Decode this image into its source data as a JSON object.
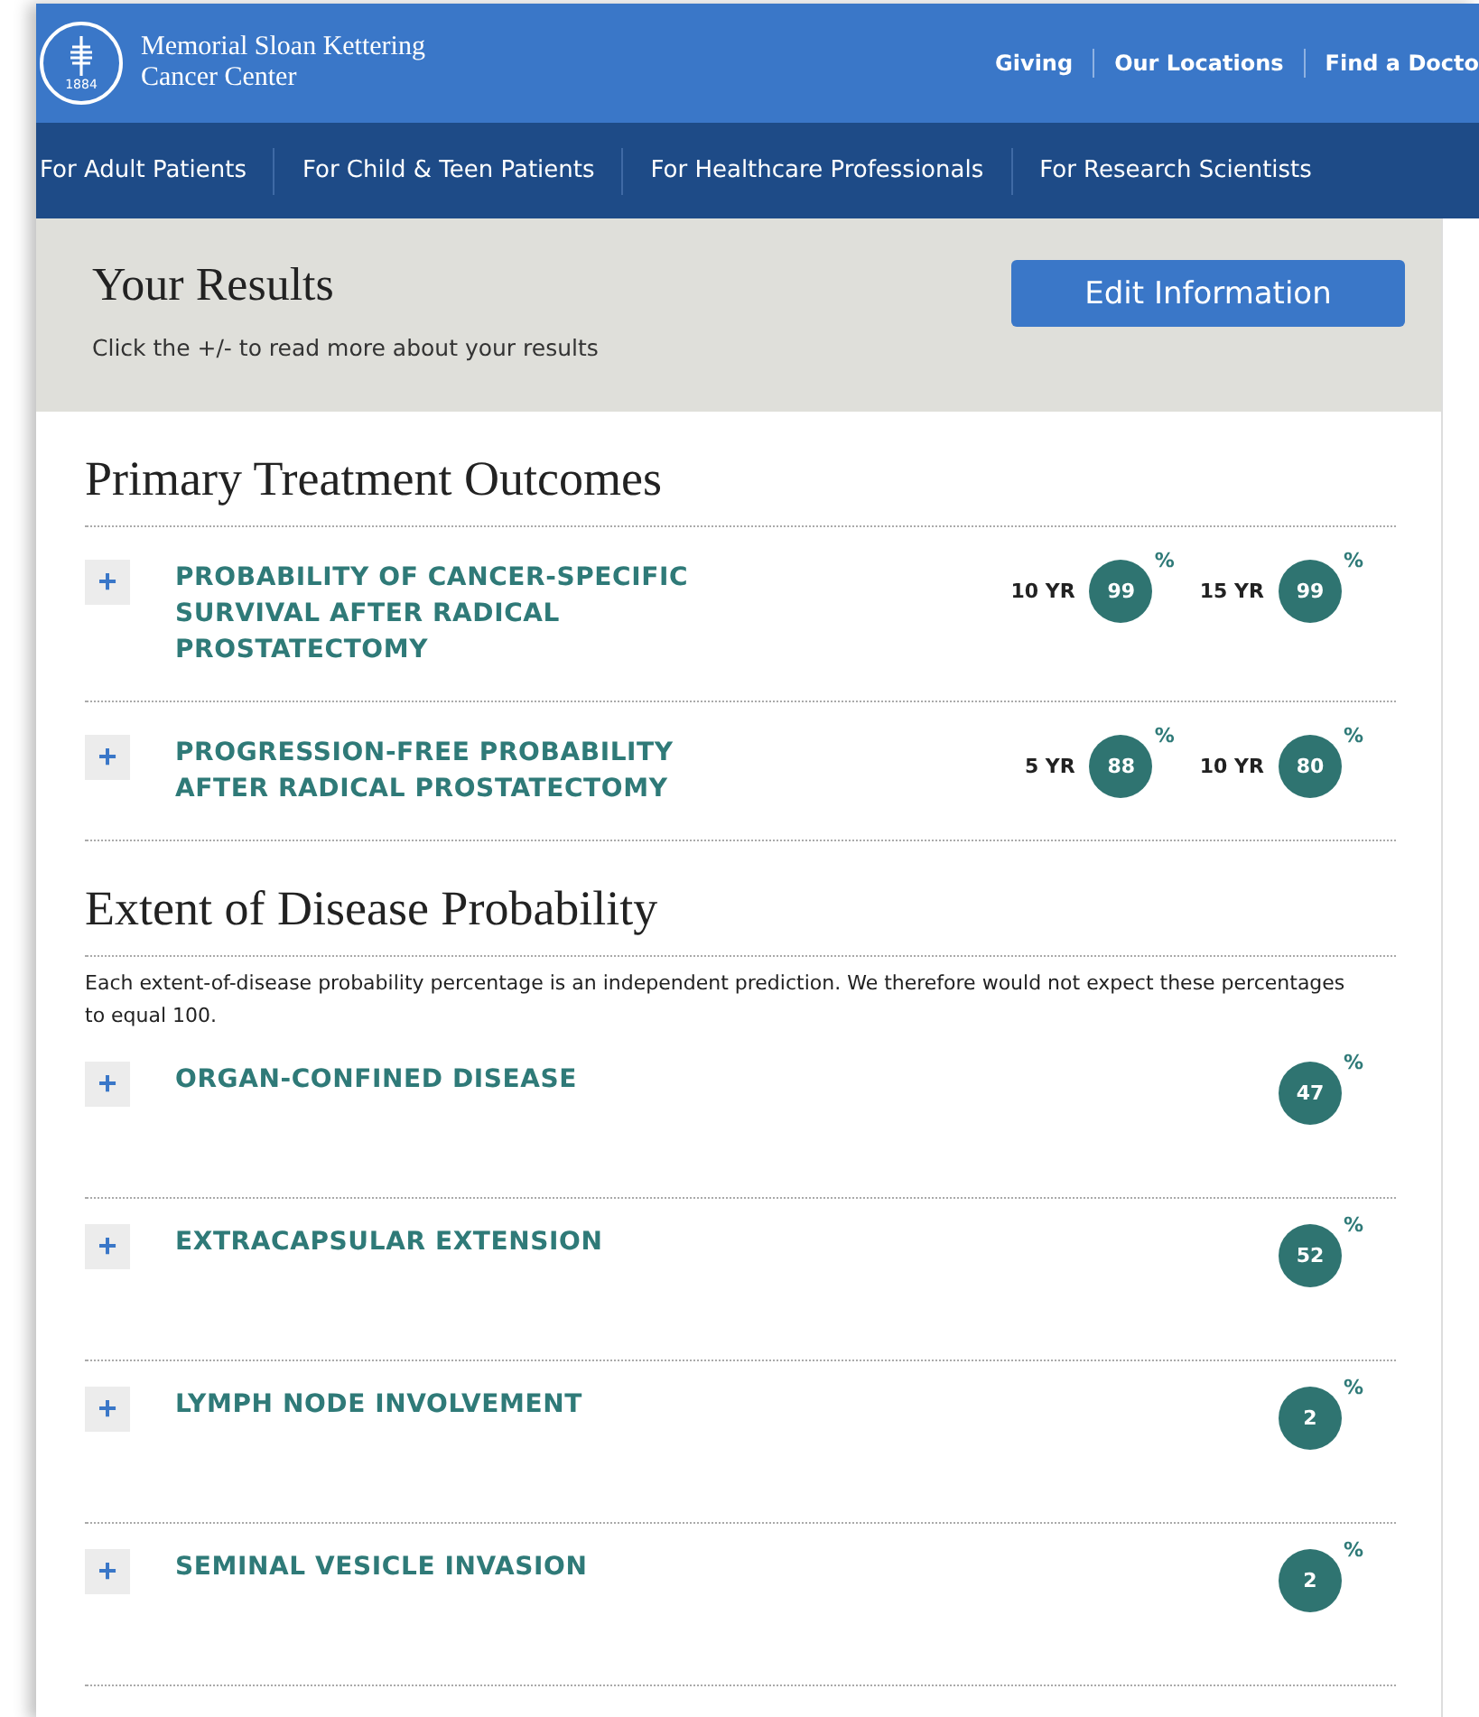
{
  "header": {
    "logo_year": "1884",
    "brand_line_1": "Memorial Sloan Kettering",
    "brand_line_2": "Cancer Center",
    "utility_links": [
      "Giving",
      "Our Locations",
      "Find a Docto"
    ]
  },
  "nav": {
    "items": [
      "For Adult Patients",
      "For Child & Teen Patients",
      "For Healthcare Professionals",
      "For Research Scientists"
    ]
  },
  "results_header": {
    "title": "Your Results",
    "subtitle": "Click the +/- to read more about your results",
    "button": "Edit Information"
  },
  "sections": [
    {
      "title": "Primary Treatment Outcomes",
      "rows": [
        {
          "toggle": "+",
          "expanded": false,
          "label": "PROBABILITY OF CANCER-SPECIFIC SURVIVAL AFTER RADICAL PROSTATECTOMY",
          "values": [
            {
              "period": "10 YR",
              "value": "99",
              "unit": "%"
            },
            {
              "period": "15 YR",
              "value": "99",
              "unit": "%"
            }
          ]
        },
        {
          "toggle": "+",
          "expanded": false,
          "label": "PROGRESSION-FREE PROBABILITY AFTER RADICAL PROSTATECTOMY",
          "values": [
            {
              "period": "5 YR",
              "value": "88",
              "unit": "%"
            },
            {
              "period": "10 YR",
              "value": "80",
              "unit": "%"
            }
          ]
        }
      ]
    },
    {
      "title": "Extent of Disease Probability",
      "note": "Each extent-of-disease probability percentage is an independent prediction. We therefore would not expect these percentages to equal 100.",
      "rows": [
        {
          "toggle": "+",
          "expanded": false,
          "label": "ORGAN-CONFINED DISEASE",
          "values": [
            {
              "value": "47",
              "unit": "%"
            }
          ]
        },
        {
          "toggle": "+",
          "expanded": false,
          "label": "EXTRACAPSULAR EXTENSION",
          "values": [
            {
              "value": "52",
              "unit": "%"
            }
          ]
        },
        {
          "toggle": "+",
          "expanded": false,
          "label": "LYMPH NODE INVOLVEMENT",
          "values": [
            {
              "value": "2",
              "unit": "%"
            }
          ]
        },
        {
          "toggle": "+",
          "expanded": false,
          "label": "SEMINAL VESICLE INVASION",
          "values": [
            {
              "value": "2",
              "unit": "%"
            }
          ]
        }
      ]
    }
  ]
}
